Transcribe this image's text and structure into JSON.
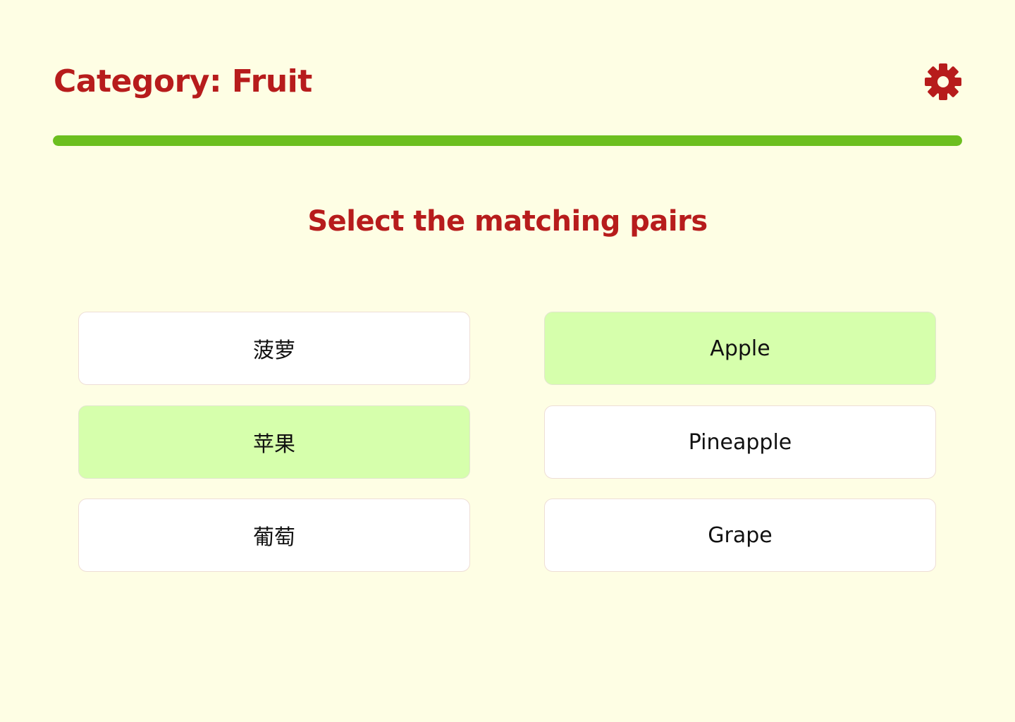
{
  "header": {
    "title": "Category: Fruit",
    "settings_icon": "gear-icon"
  },
  "progress": {
    "percent": 100
  },
  "instruction": "Select the matching pairs",
  "cards": {
    "left": [
      {
        "label": "菠萝",
        "selected": false
      },
      {
        "label": "苹果",
        "selected": true
      },
      {
        "label": "葡萄",
        "selected": false
      }
    ],
    "right": [
      {
        "label": "Apple",
        "selected": true
      },
      {
        "label": "Pineapple",
        "selected": false
      },
      {
        "label": "Grape",
        "selected": false
      }
    ]
  },
  "colors": {
    "background": "#fefee4",
    "accent": "#b71c1c",
    "progress": "#6cbf1f",
    "selected_card": "#d6ffac",
    "card": "#ffffff"
  }
}
